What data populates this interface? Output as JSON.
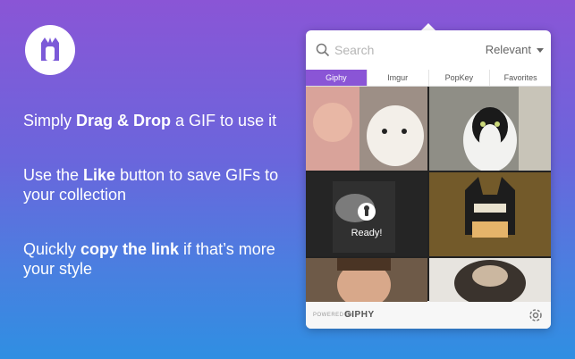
{
  "features": [
    {
      "pre": "Simply ",
      "bold": "Drag & Drop",
      "post": " a GIF to use it"
    },
    {
      "pre": "Use the ",
      "bold": "Like",
      "post": " button to save GIFs to your collection"
    },
    {
      "pre": "Quickly ",
      "bold": "copy the link",
      "post": " if that’s more your style"
    }
  ],
  "popover": {
    "search_placeholder": "Search",
    "sort_value": "Relevant",
    "tabs": [
      "Giphy",
      "Imgur",
      "PopKey",
      "Favorites"
    ],
    "active_tab": "Giphy",
    "ready_text": "Ready!",
    "powered_by": "POWERED BY",
    "provider": "GIPHY"
  },
  "colors": {
    "accent": "#8a55d6",
    "bg_top": "#8a55d6",
    "bg_bottom": "#2f8fe2"
  },
  "icons": {
    "app": "app-logo-icon",
    "search": "search-icon",
    "settings": "gear-icon"
  }
}
